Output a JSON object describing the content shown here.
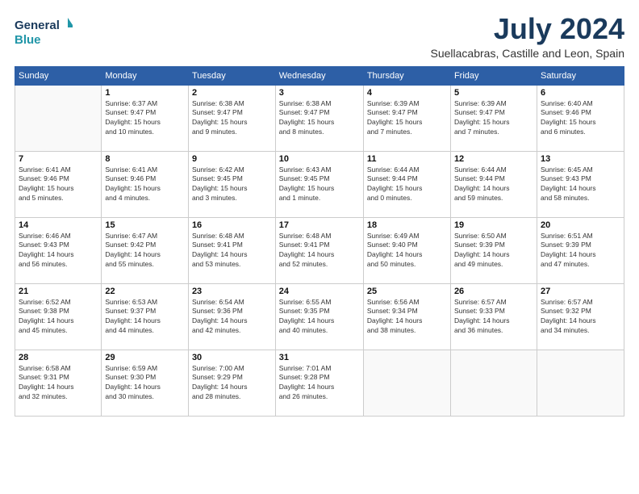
{
  "logo": {
    "line1": "General",
    "line2": "Blue"
  },
  "title": "July 2024",
  "location": "Suellacabras, Castille and Leon, Spain",
  "weekdays": [
    "Sunday",
    "Monday",
    "Tuesday",
    "Wednesday",
    "Thursday",
    "Friday",
    "Saturday"
  ],
  "weeks": [
    [
      {
        "day": "",
        "info": ""
      },
      {
        "day": "1",
        "info": "Sunrise: 6:37 AM\nSunset: 9:47 PM\nDaylight: 15 hours\nand 10 minutes."
      },
      {
        "day": "2",
        "info": "Sunrise: 6:38 AM\nSunset: 9:47 PM\nDaylight: 15 hours\nand 9 minutes."
      },
      {
        "day": "3",
        "info": "Sunrise: 6:38 AM\nSunset: 9:47 PM\nDaylight: 15 hours\nand 8 minutes."
      },
      {
        "day": "4",
        "info": "Sunrise: 6:39 AM\nSunset: 9:47 PM\nDaylight: 15 hours\nand 7 minutes."
      },
      {
        "day": "5",
        "info": "Sunrise: 6:39 AM\nSunset: 9:47 PM\nDaylight: 15 hours\nand 7 minutes."
      },
      {
        "day": "6",
        "info": "Sunrise: 6:40 AM\nSunset: 9:46 PM\nDaylight: 15 hours\nand 6 minutes."
      }
    ],
    [
      {
        "day": "7",
        "info": "Sunrise: 6:41 AM\nSunset: 9:46 PM\nDaylight: 15 hours\nand 5 minutes."
      },
      {
        "day": "8",
        "info": "Sunrise: 6:41 AM\nSunset: 9:46 PM\nDaylight: 15 hours\nand 4 minutes."
      },
      {
        "day": "9",
        "info": "Sunrise: 6:42 AM\nSunset: 9:45 PM\nDaylight: 15 hours\nand 3 minutes."
      },
      {
        "day": "10",
        "info": "Sunrise: 6:43 AM\nSunset: 9:45 PM\nDaylight: 15 hours\nand 1 minute."
      },
      {
        "day": "11",
        "info": "Sunrise: 6:44 AM\nSunset: 9:44 PM\nDaylight: 15 hours\nand 0 minutes."
      },
      {
        "day": "12",
        "info": "Sunrise: 6:44 AM\nSunset: 9:44 PM\nDaylight: 14 hours\nand 59 minutes."
      },
      {
        "day": "13",
        "info": "Sunrise: 6:45 AM\nSunset: 9:43 PM\nDaylight: 14 hours\nand 58 minutes."
      }
    ],
    [
      {
        "day": "14",
        "info": "Sunrise: 6:46 AM\nSunset: 9:43 PM\nDaylight: 14 hours\nand 56 minutes."
      },
      {
        "day": "15",
        "info": "Sunrise: 6:47 AM\nSunset: 9:42 PM\nDaylight: 14 hours\nand 55 minutes."
      },
      {
        "day": "16",
        "info": "Sunrise: 6:48 AM\nSunset: 9:41 PM\nDaylight: 14 hours\nand 53 minutes."
      },
      {
        "day": "17",
        "info": "Sunrise: 6:48 AM\nSunset: 9:41 PM\nDaylight: 14 hours\nand 52 minutes."
      },
      {
        "day": "18",
        "info": "Sunrise: 6:49 AM\nSunset: 9:40 PM\nDaylight: 14 hours\nand 50 minutes."
      },
      {
        "day": "19",
        "info": "Sunrise: 6:50 AM\nSunset: 9:39 PM\nDaylight: 14 hours\nand 49 minutes."
      },
      {
        "day": "20",
        "info": "Sunrise: 6:51 AM\nSunset: 9:39 PM\nDaylight: 14 hours\nand 47 minutes."
      }
    ],
    [
      {
        "day": "21",
        "info": "Sunrise: 6:52 AM\nSunset: 9:38 PM\nDaylight: 14 hours\nand 45 minutes."
      },
      {
        "day": "22",
        "info": "Sunrise: 6:53 AM\nSunset: 9:37 PM\nDaylight: 14 hours\nand 44 minutes."
      },
      {
        "day": "23",
        "info": "Sunrise: 6:54 AM\nSunset: 9:36 PM\nDaylight: 14 hours\nand 42 minutes."
      },
      {
        "day": "24",
        "info": "Sunrise: 6:55 AM\nSunset: 9:35 PM\nDaylight: 14 hours\nand 40 minutes."
      },
      {
        "day": "25",
        "info": "Sunrise: 6:56 AM\nSunset: 9:34 PM\nDaylight: 14 hours\nand 38 minutes."
      },
      {
        "day": "26",
        "info": "Sunrise: 6:57 AM\nSunset: 9:33 PM\nDaylight: 14 hours\nand 36 minutes."
      },
      {
        "day": "27",
        "info": "Sunrise: 6:57 AM\nSunset: 9:32 PM\nDaylight: 14 hours\nand 34 minutes."
      }
    ],
    [
      {
        "day": "28",
        "info": "Sunrise: 6:58 AM\nSunset: 9:31 PM\nDaylight: 14 hours\nand 32 minutes."
      },
      {
        "day": "29",
        "info": "Sunrise: 6:59 AM\nSunset: 9:30 PM\nDaylight: 14 hours\nand 30 minutes."
      },
      {
        "day": "30",
        "info": "Sunrise: 7:00 AM\nSunset: 9:29 PM\nDaylight: 14 hours\nand 28 minutes."
      },
      {
        "day": "31",
        "info": "Sunrise: 7:01 AM\nSunset: 9:28 PM\nDaylight: 14 hours\nand 26 minutes."
      },
      {
        "day": "",
        "info": ""
      },
      {
        "day": "",
        "info": ""
      },
      {
        "day": "",
        "info": ""
      }
    ]
  ]
}
